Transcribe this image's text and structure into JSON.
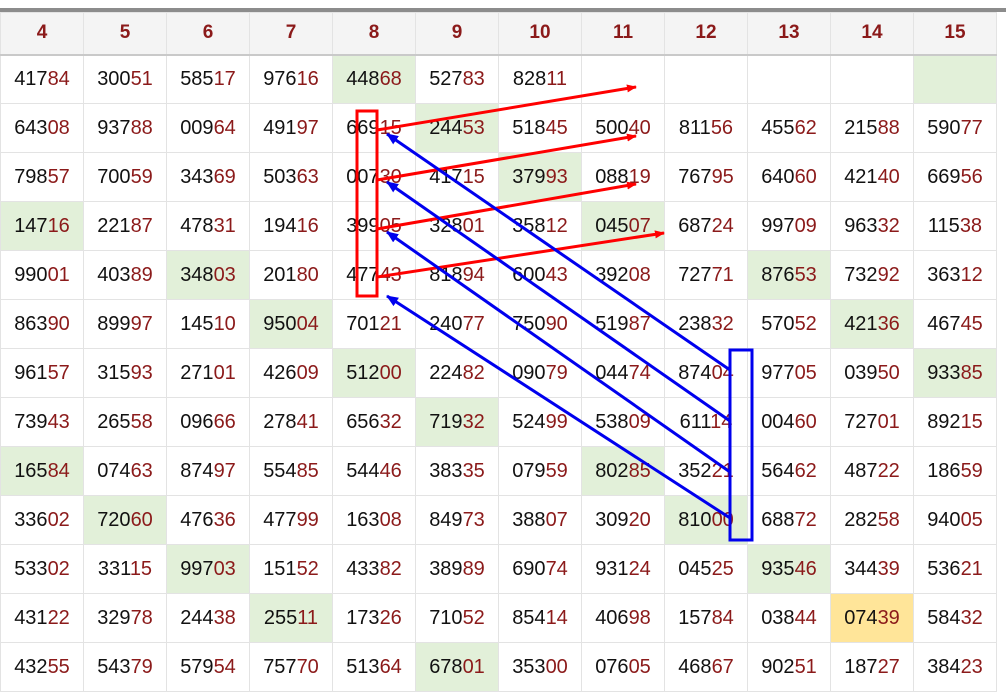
{
  "header": {
    "columns": [
      "4",
      "5",
      "6",
      "7",
      "8",
      "9",
      "10",
      "11",
      "12",
      "13",
      "14",
      "15"
    ]
  },
  "table": {
    "rows": [
      [
        "41784",
        "30051",
        "58517",
        "97616",
        "44868",
        "52783",
        "82811",
        "",
        "",
        "",
        "",
        ""
      ],
      [
        "64308",
        "93788",
        "00964",
        "49197",
        "66915",
        "24453",
        "51845",
        "50040",
        "81156",
        "45562",
        "21588",
        "59077"
      ],
      [
        "79857",
        "70059",
        "34369",
        "50363",
        "00730",
        "41715",
        "37993",
        "08819",
        "76795",
        "64060",
        "42140",
        "66956"
      ],
      [
        "14716",
        "22187",
        "47831",
        "19416",
        "39905",
        "32801",
        "35812",
        "04507",
        "68724",
        "99709",
        "96332",
        "11538"
      ],
      [
        "99001",
        "40389",
        "34803",
        "20180",
        "47743",
        "81894",
        "60043",
        "39208",
        "72771",
        "87653",
        "73292",
        "36312"
      ],
      [
        "86390",
        "89997",
        "14510",
        "95004",
        "70121",
        "24077",
        "75090",
        "51987",
        "23832",
        "57052",
        "42136",
        "46745"
      ],
      [
        "96157",
        "31593",
        "27101",
        "42609",
        "51200",
        "22482",
        "09079",
        "04474",
        "87404",
        "97705",
        "03950",
        "93385"
      ],
      [
        "73943",
        "26558",
        "09666",
        "27841",
        "65632",
        "71932",
        "52499",
        "53809",
        "61114",
        "00460",
        "72701",
        "89215"
      ],
      [
        "16584",
        "07463",
        "87497",
        "55485",
        "54446",
        "38335",
        "07959",
        "80285",
        "35221",
        "56462",
        "48722",
        "18659"
      ],
      [
        "33602",
        "72060",
        "47636",
        "47799",
        "16308",
        "84973",
        "38807",
        "30920",
        "81000",
        "68872",
        "28258",
        "94005"
      ],
      [
        "53302",
        "33115",
        "99703",
        "15152",
        "43382",
        "38989",
        "69074",
        "93124",
        "04525",
        "93546",
        "34439",
        "53621"
      ],
      [
        "43122",
        "32978",
        "24438",
        "25511",
        "17326",
        "71052",
        "85414",
        "40698",
        "15784",
        "03844",
        "07439",
        "58432"
      ],
      [
        "43255",
        "54379",
        "57954",
        "75770",
        "51364",
        "67801",
        "35300",
        "07605",
        "46867",
        "90251",
        "18727",
        "38423"
      ]
    ],
    "highlights": [
      {
        "row": 0,
        "col": 4,
        "color": "green"
      },
      {
        "row": 0,
        "col": 11,
        "color": "green"
      },
      {
        "row": 1,
        "col": 5,
        "color": "green"
      },
      {
        "row": 2,
        "col": 6,
        "color": "green"
      },
      {
        "row": 3,
        "col": 0,
        "color": "green"
      },
      {
        "row": 3,
        "col": 7,
        "color": "green"
      },
      {
        "row": 4,
        "col": 2,
        "color": "green"
      },
      {
        "row": 4,
        "col": 9,
        "color": "green"
      },
      {
        "row": 5,
        "col": 3,
        "color": "green"
      },
      {
        "row": 5,
        "col": 10,
        "color": "green"
      },
      {
        "row": 6,
        "col": 4,
        "color": "green"
      },
      {
        "row": 6,
        "col": 11,
        "color": "green"
      },
      {
        "row": 7,
        "col": 5,
        "color": "green"
      },
      {
        "row": 8,
        "col": 0,
        "color": "green"
      },
      {
        "row": 8,
        "col": 7,
        "color": "green"
      },
      {
        "row": 9,
        "col": 1,
        "color": "green"
      },
      {
        "row": 9,
        "col": 8,
        "color": "green"
      },
      {
        "row": 10,
        "col": 2,
        "color": "green"
      },
      {
        "row": 10,
        "col": 9,
        "color": "green"
      },
      {
        "row": 11,
        "col": 3,
        "color": "green"
      },
      {
        "row": 11,
        "col": 10,
        "color": "yellow"
      },
      {
        "row": 12,
        "col": 5,
        "color": "green"
      }
    ]
  },
  "annotations": {
    "red_color": "#ff0000",
    "blue_color": "#0000ee"
  }
}
